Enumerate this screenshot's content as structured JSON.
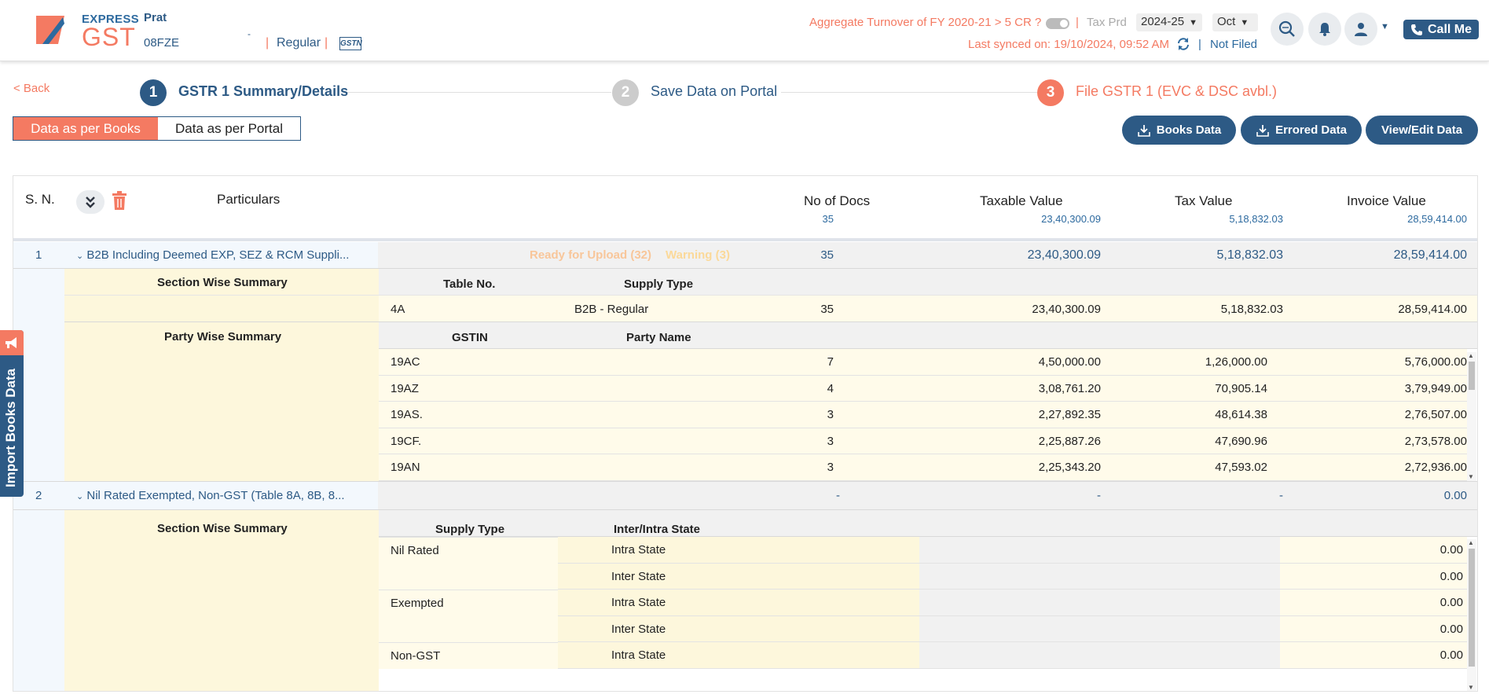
{
  "header": {
    "logo_express": "EXPRESS",
    "logo_gst": "GST",
    "user_name": "Prat",
    "gstin": "08FZE",
    "user_mark": "-",
    "sep": "|",
    "reg_type": "Regular",
    "gstn_logo": "GSTN",
    "agg_turnover": "Aggregate Turnover of FY 2020-21 > 5 CR ?",
    "tax_prd_label": "Tax Prd",
    "year": "2024-25",
    "month": "Oct",
    "last_synced": "Last synced on: 19/10/2024, 09:52 AM",
    "status": "Not Filed",
    "call_me": "Call Me"
  },
  "steps": {
    "back": "< Back",
    "items": [
      {
        "num": "1",
        "label": "GSTR 1 Summary/Details",
        "color": "#2d5a85"
      },
      {
        "num": "2",
        "label": "Save Data on Portal",
        "color": "#cccccc"
      },
      {
        "num": "3",
        "label": "File GSTR 1 (EVC & DSC avbl.)",
        "color": "#f47a62"
      }
    ]
  },
  "view_toggle": {
    "books": "Data as per Books",
    "portal": "Data as per Portal"
  },
  "actions": {
    "books_data": "Books Data",
    "errored_data": "Errored Data",
    "view_edit": "View/Edit Data"
  },
  "table": {
    "headers": {
      "sn": "S. N.",
      "particulars": "Particulars",
      "no_docs": "No of Docs",
      "taxable": "Taxable Value",
      "tax": "Tax Value",
      "invoice": "Invoice Value"
    },
    "totals": {
      "no_docs": "35",
      "taxable": "23,40,300.09",
      "tax": "5,18,832.03",
      "invoice": "28,59,414.00"
    },
    "b2b": {
      "sn": "1",
      "name": "B2B Including Deemed EXP, SEZ & RCM Suppli...",
      "ready": "Ready for Upload (32)",
      "warning": "Warning (3)",
      "no_docs": "35",
      "taxable": "23,40,300.09",
      "tax": "5,18,832.03",
      "invoice": "28,59,414.00",
      "section_label": "Section Wise Summary",
      "section_cols": [
        "Table No.",
        "Supply Type"
      ],
      "section_row": {
        "table_no": "4A",
        "supply": "B2B - Regular",
        "no_docs": "35",
        "taxable": "23,40,300.09",
        "tax": "5,18,832.03",
        "invoice": "28,59,414.00"
      },
      "party_label": "Party Wise Summary",
      "party_cols": [
        "GSTIN",
        "Party Name"
      ],
      "party_rows": [
        {
          "gstin": "19AC",
          "docs": "7",
          "taxable": "4,50,000.00",
          "tax": "1,26,000.00",
          "invoice": "5,76,000.00"
        },
        {
          "gstin": "19AZ",
          "docs": "4",
          "taxable": "3,08,761.20",
          "tax": "70,905.14",
          "invoice": "3,79,949.00"
        },
        {
          "gstin": "19AS.",
          "docs": "3",
          "taxable": "2,27,892.35",
          "tax": "48,614.38",
          "invoice": "2,76,507.00"
        },
        {
          "gstin": "19CF.",
          "docs": "3",
          "taxable": "2,25,887.26",
          "tax": "47,690.96",
          "invoice": "2,73,578.00"
        },
        {
          "gstin": "19AN",
          "docs": "3",
          "taxable": "2,25,343.20",
          "tax": "47,593.02",
          "invoice": "2,72,936.00"
        }
      ]
    },
    "nil": {
      "sn": "2",
      "name": "Nil Rated Exempted, Non-GST (Table 8A, 8B, 8...",
      "no_docs": "-",
      "taxable": "-",
      "tax": "-",
      "invoice": "0.00",
      "section_label": "Section Wise Summary",
      "section_cols": [
        "Supply Type",
        "Inter/Intra State"
      ],
      "rows": [
        {
          "type": "Nil Rated",
          "state": "Intra State",
          "value": "0.00"
        },
        {
          "type": "",
          "state": "Inter State",
          "value": "0.00"
        },
        {
          "type": "Exempted",
          "state": "Intra State",
          "value": "0.00"
        },
        {
          "type": "",
          "state": "Inter State",
          "value": "0.00"
        },
        {
          "type": "Non-GST",
          "state": "Intra State",
          "value": "0.00"
        }
      ]
    }
  },
  "import_tab": "Import Books Data",
  "colors": {
    "brand_blue": "#2d5a85",
    "brand_orange": "#f47a62"
  }
}
